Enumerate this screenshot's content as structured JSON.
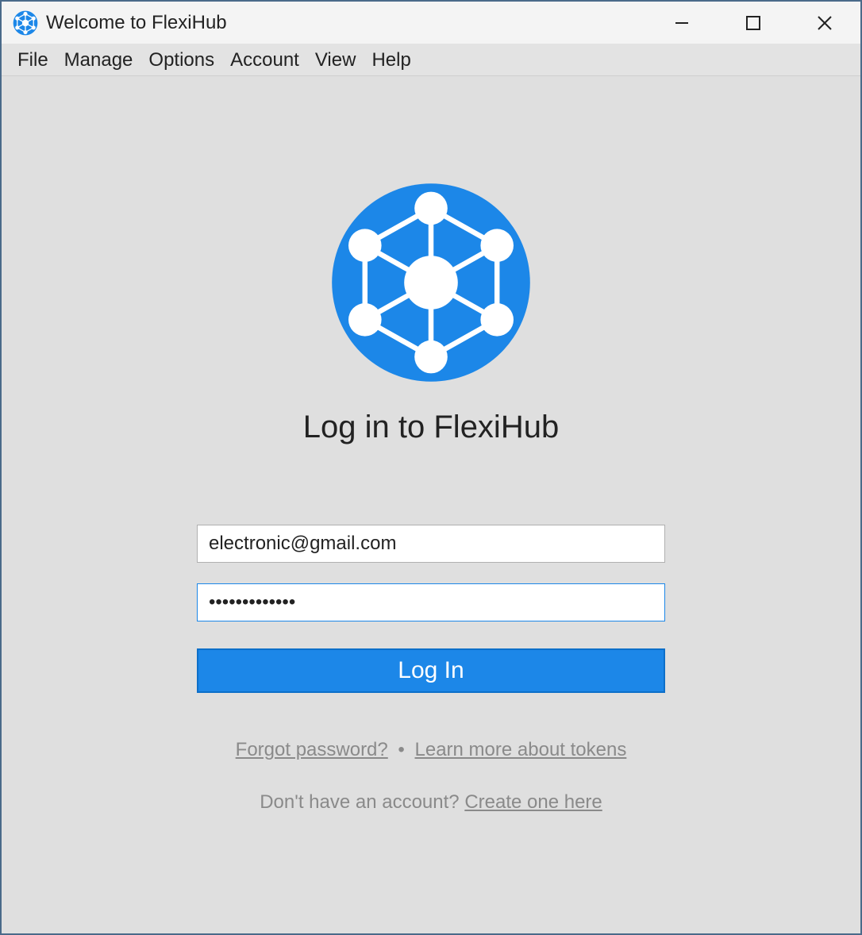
{
  "titlebar": {
    "title": "Welcome to FlexiHub"
  },
  "menu": {
    "items": [
      "File",
      "Manage",
      "Options",
      "Account",
      "View",
      "Help"
    ]
  },
  "login": {
    "heading": "Log in to FlexiHub",
    "email_value": "electronic@gmail.com",
    "password_value": "•••••••••••••",
    "button_label": "Log In",
    "forgot_label": "Forgot password?",
    "separator": "•",
    "tokens_label": "Learn more about tokens",
    "no_account_text": "Don't have an account? ",
    "create_label": "Create one here"
  },
  "colors": {
    "accent": "#1c87e8",
    "background": "#dfdfdf"
  }
}
